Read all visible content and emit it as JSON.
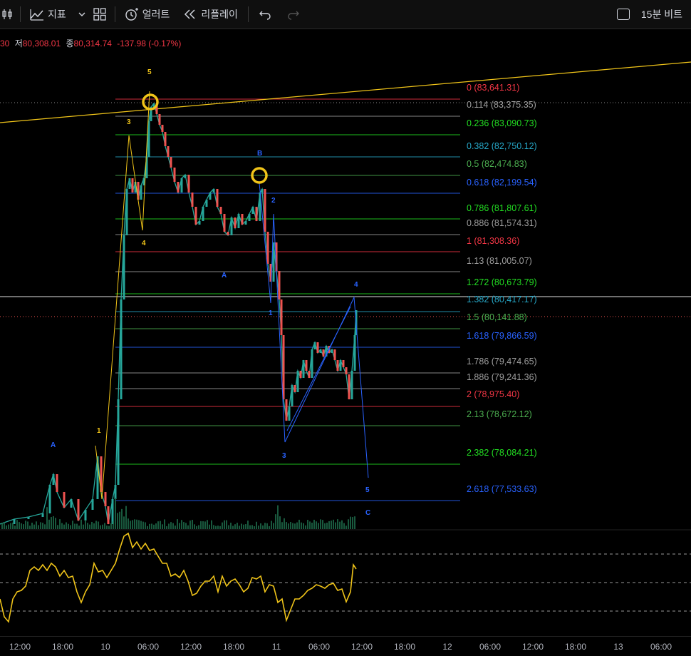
{
  "toolbar": {
    "indicators_label": "지표",
    "alerts_label": "얼러트",
    "replay_label": "리플레이",
    "bar_replay_toggle_label": "15분 비트"
  },
  "legend": {
    "prefix": "30",
    "low_label": "저",
    "low_value": "80,308.01",
    "close_label": "종",
    "close_value": "80,314.74",
    "change": "-137.98 (-0.17%)"
  },
  "fib_levels": [
    {
      "label": "0 (83,641.31)",
      "color": "#f23645"
    },
    {
      "label": "0.114 (83,375.35)",
      "color": "#9e9e9e"
    },
    {
      "label": "0.236 (83,090.73)",
      "color": "#22dd22"
    },
    {
      "label": "0.382 (82,750.12)",
      "color": "#26a6c6"
    },
    {
      "label": "0.5 (82,474.83)",
      "color": "#4caf50"
    },
    {
      "label": "0.618 (82,199.54)",
      "color": "#2962ff"
    },
    {
      "label": "0.786 (81,807.61)",
      "color": "#22dd22"
    },
    {
      "label": "0.886 (81,574.31)",
      "color": "#9e9e9e"
    },
    {
      "label": "1 (81,308.36)",
      "color": "#f23645"
    },
    {
      "label": "1.13 (81,005.07)",
      "color": "#9e9e9e"
    },
    {
      "label": "1.272 (80,673.79)",
      "color": "#22dd22"
    },
    {
      "label": "1.382 (80,417.17)",
      "color": "#26a6c6"
    },
    {
      "label": "1.5 (80,141.88)",
      "color": "#4caf50"
    },
    {
      "label": "1.618 (79,866.59)",
      "color": "#2962ff"
    },
    {
      "label": "1.786 (79,474.65)",
      "color": "#9e9e9e"
    },
    {
      "label": "1.886 (79,241.36)",
      "color": "#9e9e9e"
    },
    {
      "label": "2 (78,975.40)",
      "color": "#f23645"
    },
    {
      "label": "2.13 (78,672.12)",
      "color": "#4caf50"
    },
    {
      "label": "2.382 (78,084.21)",
      "color": "#22dd22"
    },
    {
      "label": "2.618 (77,533.63)",
      "color": "#2962ff"
    }
  ],
  "wave_labels": [
    {
      "text": "5",
      "color": "#f0c419"
    },
    {
      "text": "3",
      "color": "#f0c419"
    },
    {
      "text": "4",
      "color": "#f0c419"
    },
    {
      "text": "1",
      "color": "#f0c419"
    },
    {
      "text": "A",
      "color": "#2962ff"
    },
    {
      "text": "B",
      "color": "#2962ff"
    },
    {
      "text": "2",
      "color": "#2962ff"
    },
    {
      "text": "A",
      "color": "#2962ff"
    },
    {
      "text": "1",
      "color": "#2962ff"
    },
    {
      "text": "3",
      "color": "#2962ff"
    },
    {
      "text": "4",
      "color": "#2962ff"
    },
    {
      "text": "5",
      "color": "#2962ff"
    },
    {
      "text": "C",
      "color": "#2962ff"
    }
  ],
  "x_axis_ticks": [
    "12:00",
    "18:00",
    "10",
    "06:00",
    "12:00",
    "18:00",
    "11",
    "06:00",
    "12:00",
    "18:00",
    "12",
    "06:00",
    "12:00",
    "18:00",
    "13",
    "06:00"
  ],
  "colors": {
    "up": "#26a69a",
    "down": "#ef5350",
    "oscillator": "#f0c419",
    "trendline": "#f0c419",
    "highlight_circle": "#f0c419"
  }
}
